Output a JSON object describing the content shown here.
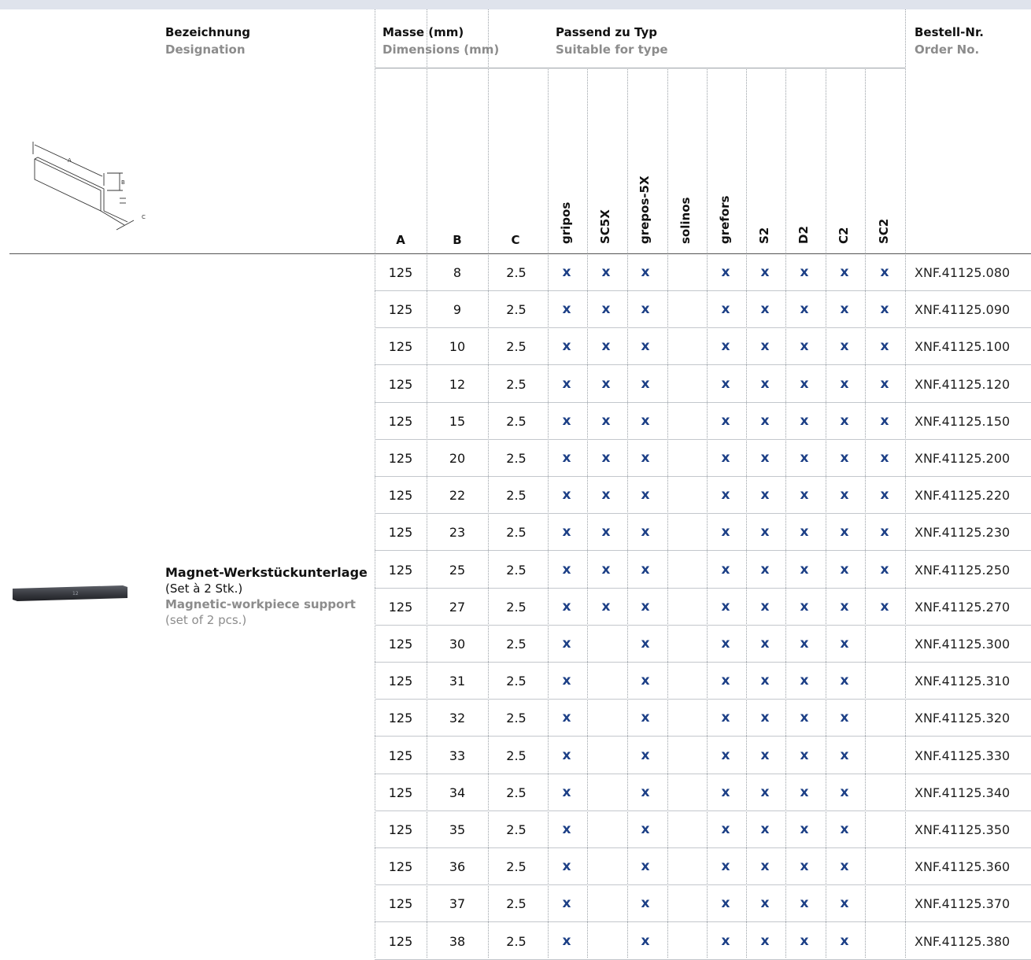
{
  "header": {
    "designation_de": "Bezeichnung",
    "designation_en": "Designation",
    "dims_de": "Masse (mm)",
    "dims_en": "Dimensions (mm)",
    "types_de": "Passend zu Typ",
    "types_en": "Suitable for type",
    "order_de": "Bestell-Nr.",
    "order_en": "Order No."
  },
  "dim_columns": [
    "A",
    "B",
    "C"
  ],
  "type_columns": [
    "gripos",
    "SC5X",
    "grepos-5X",
    "solinos",
    "grefors",
    "S2",
    "D2",
    "C2",
    "SC2"
  ],
  "diagram_labels": {
    "a": "A",
    "b": "B",
    "c": "C"
  },
  "product": {
    "name_de": "Magnet-Werkstückunterlage",
    "set_de": "(Set à 2 Stk.)",
    "name_en": "Magnetic-workpiece support",
    "set_en": "(set of 2 pcs.)",
    "image_label": "12"
  },
  "mark": "x",
  "rows": [
    {
      "A": "125",
      "B": "8",
      "C": "2.5",
      "types": [
        1,
        1,
        1,
        0,
        1,
        1,
        1,
        1,
        1
      ],
      "order": "XNF.41125.080"
    },
    {
      "A": "125",
      "B": "9",
      "C": "2.5",
      "types": [
        1,
        1,
        1,
        0,
        1,
        1,
        1,
        1,
        1
      ],
      "order": "XNF.41125.090"
    },
    {
      "A": "125",
      "B": "10",
      "C": "2.5",
      "types": [
        1,
        1,
        1,
        0,
        1,
        1,
        1,
        1,
        1
      ],
      "order": "XNF.41125.100"
    },
    {
      "A": "125",
      "B": "12",
      "C": "2.5",
      "types": [
        1,
        1,
        1,
        0,
        1,
        1,
        1,
        1,
        1
      ],
      "order": "XNF.41125.120"
    },
    {
      "A": "125",
      "B": "15",
      "C": "2.5",
      "types": [
        1,
        1,
        1,
        0,
        1,
        1,
        1,
        1,
        1
      ],
      "order": "XNF.41125.150"
    },
    {
      "A": "125",
      "B": "20",
      "C": "2.5",
      "types": [
        1,
        1,
        1,
        0,
        1,
        1,
        1,
        1,
        1
      ],
      "order": "XNF.41125.200"
    },
    {
      "A": "125",
      "B": "22",
      "C": "2.5",
      "types": [
        1,
        1,
        1,
        0,
        1,
        1,
        1,
        1,
        1
      ],
      "order": "XNF.41125.220"
    },
    {
      "A": "125",
      "B": "23",
      "C": "2.5",
      "types": [
        1,
        1,
        1,
        0,
        1,
        1,
        1,
        1,
        1
      ],
      "order": "XNF.41125.230"
    },
    {
      "A": "125",
      "B": "25",
      "C": "2.5",
      "types": [
        1,
        1,
        1,
        0,
        1,
        1,
        1,
        1,
        1
      ],
      "order": "XNF.41125.250"
    },
    {
      "A": "125",
      "B": "27",
      "C": "2.5",
      "types": [
        1,
        1,
        1,
        0,
        1,
        1,
        1,
        1,
        1
      ],
      "order": "XNF.41125.270"
    },
    {
      "A": "125",
      "B": "30",
      "C": "2.5",
      "types": [
        1,
        0,
        1,
        0,
        1,
        1,
        1,
        1,
        0
      ],
      "order": "XNF.41125.300"
    },
    {
      "A": "125",
      "B": "31",
      "C": "2.5",
      "types": [
        1,
        0,
        1,
        0,
        1,
        1,
        1,
        1,
        0
      ],
      "order": "XNF.41125.310"
    },
    {
      "A": "125",
      "B": "32",
      "C": "2.5",
      "types": [
        1,
        0,
        1,
        0,
        1,
        1,
        1,
        1,
        0
      ],
      "order": "XNF.41125.320"
    },
    {
      "A": "125",
      "B": "33",
      "C": "2.5",
      "types": [
        1,
        0,
        1,
        0,
        1,
        1,
        1,
        1,
        0
      ],
      "order": "XNF.41125.330"
    },
    {
      "A": "125",
      "B": "34",
      "C": "2.5",
      "types": [
        1,
        0,
        1,
        0,
        1,
        1,
        1,
        1,
        0
      ],
      "order": "XNF.41125.340"
    },
    {
      "A": "125",
      "B": "35",
      "C": "2.5",
      "types": [
        1,
        0,
        1,
        0,
        1,
        1,
        1,
        1,
        0
      ],
      "order": "XNF.41125.350"
    },
    {
      "A": "125",
      "B": "36",
      "C": "2.5",
      "types": [
        1,
        0,
        1,
        0,
        1,
        1,
        1,
        1,
        0
      ],
      "order": "XNF.41125.360"
    },
    {
      "A": "125",
      "B": "37",
      "C": "2.5",
      "types": [
        1,
        0,
        1,
        0,
        1,
        1,
        1,
        1,
        0
      ],
      "order": "XNF.41125.370"
    },
    {
      "A": "125",
      "B": "38",
      "C": "2.5",
      "types": [
        1,
        0,
        1,
        0,
        1,
        1,
        1,
        1,
        0
      ],
      "order": "XNF.41125.380"
    }
  ]
}
